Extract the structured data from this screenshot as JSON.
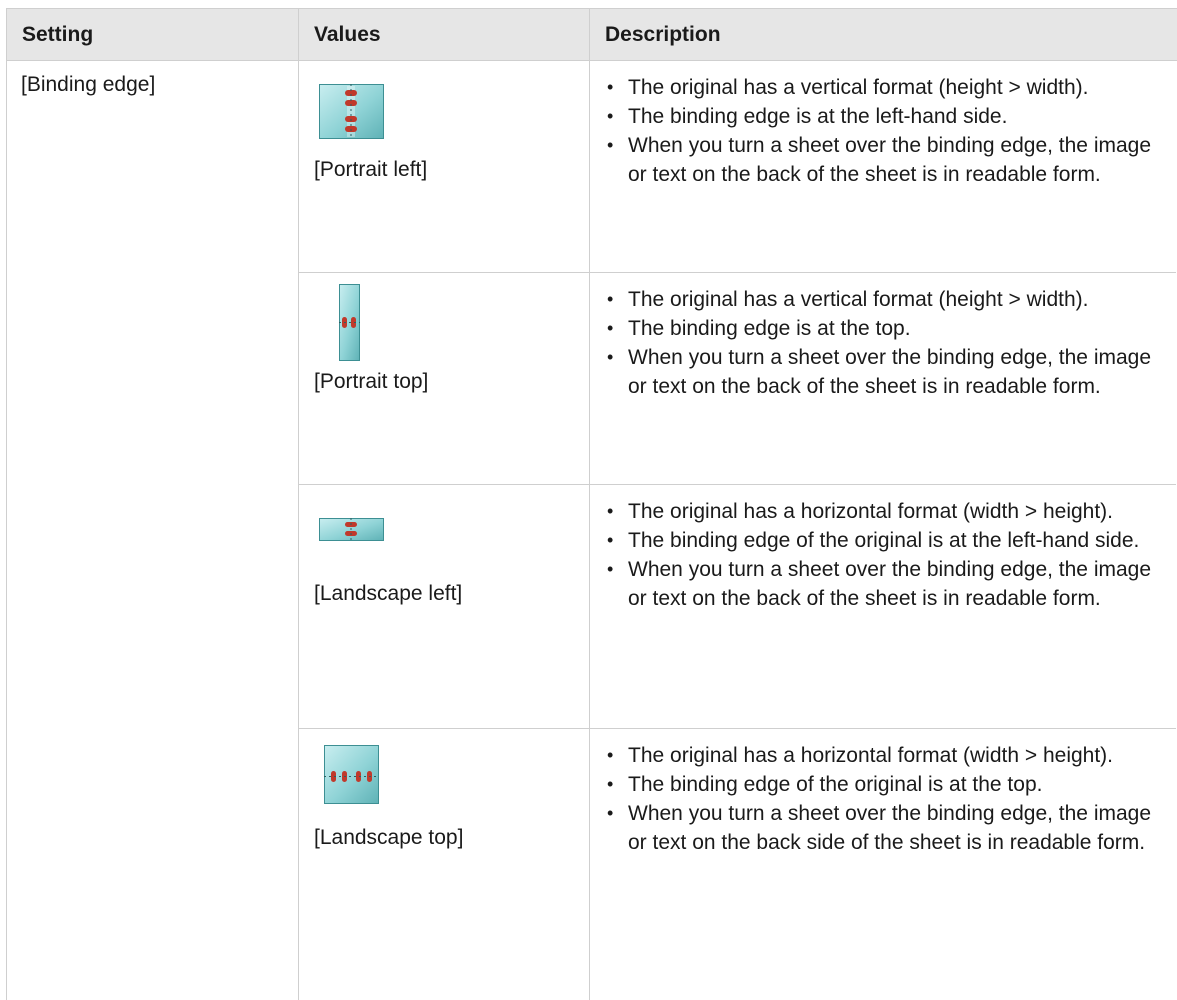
{
  "header": {
    "setting": "Setting",
    "values": "Values",
    "description": "Description"
  },
  "setting_name": "[Binding edge]",
  "rows": [
    {
      "value_label": "[Portrait left]",
      "icon": "portrait-left-icon",
      "bullets": [
        "The original has a vertical format (height > width).",
        "The binding edge is at the left-hand side.",
        "When you turn a sheet over the binding edge, the image or text on the back of the sheet is in readable form."
      ]
    },
    {
      "value_label": "[Portrait top]",
      "icon": "portrait-top-icon",
      "bullets": [
        "The original has a vertical format (height > width).",
        "The binding edge is at the top.",
        "When you turn a sheet over the binding edge, the image or text on the back of the sheet is in readable form."
      ]
    },
    {
      "value_label": "[Landscape left]",
      "icon": "landscape-left-icon",
      "bullets": [
        "The original has a horizontal format (width > height).",
        "The binding edge of the original is at the left-hand side.",
        "When you turn a sheet over the binding edge, the image or text on the back of the sheet is in readable form."
      ]
    },
    {
      "value_label": "[Landscape top]",
      "icon": "landscape-top-icon",
      "bullets": [
        "The original has a horizontal format (width > height).",
        "The binding edge of the original is at the top.",
        "When you turn a sheet over the binding edge, the image or text on the back side of the sheet is in readable form."
      ]
    }
  ]
}
